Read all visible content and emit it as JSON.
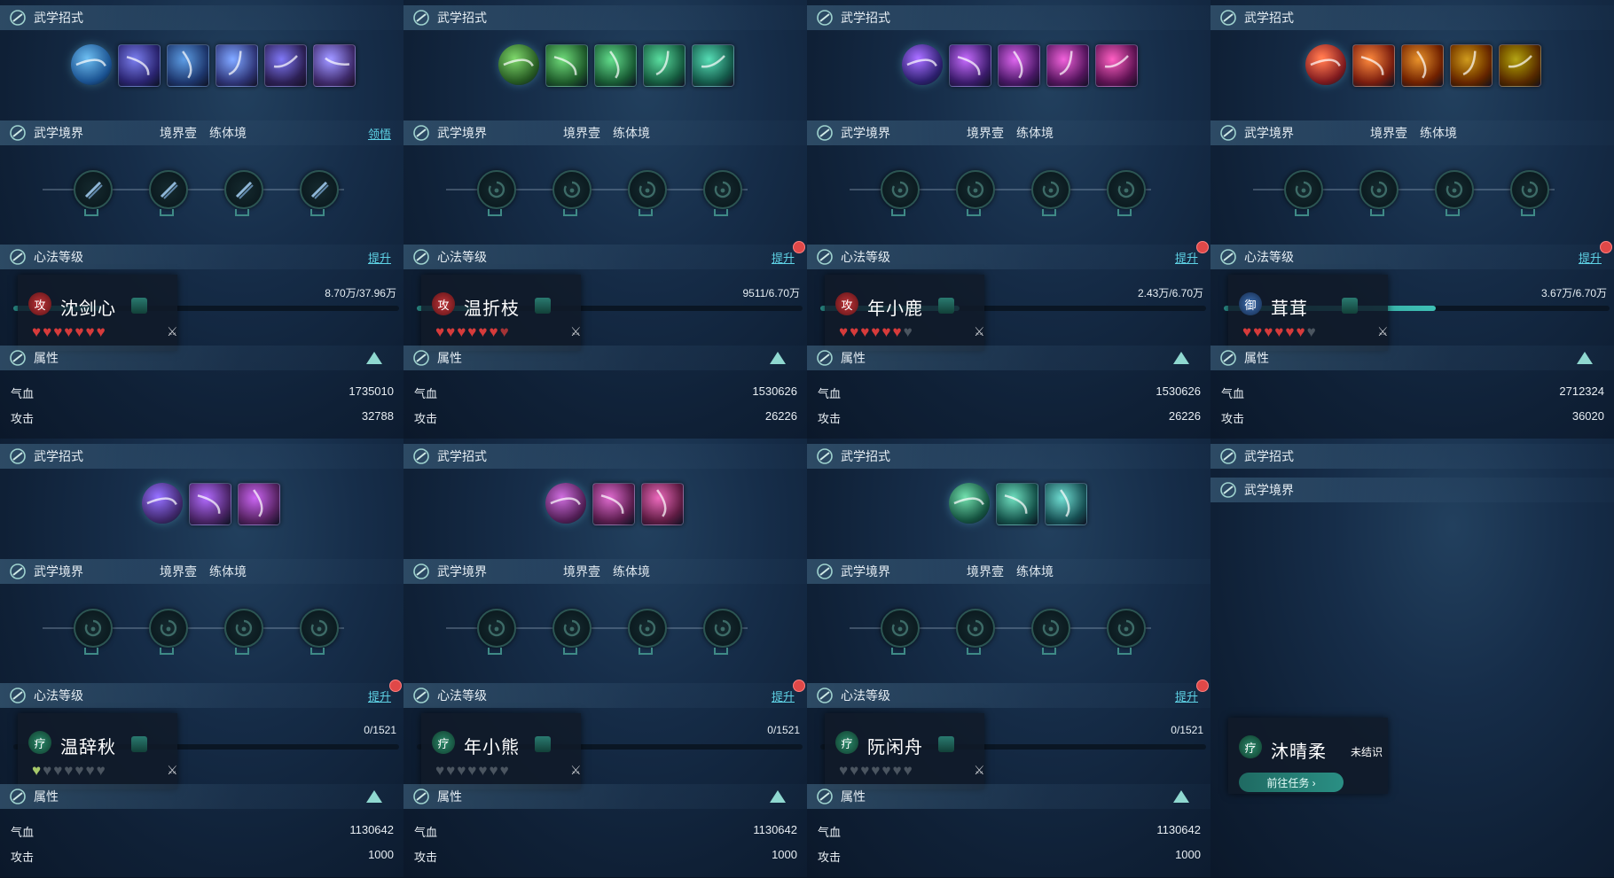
{
  "colors": {
    "accent": "#5fd3e6",
    "heart_red": "#d63b3b",
    "heart_green": "#a7c96a",
    "bar_teal": "#3ec0b5",
    "badge_red": "#e04848"
  },
  "panels": [
    {
      "skills_label": "武学招式",
      "realm_label": "武学境界",
      "realm_tags": [
        "境界壹",
        "练体境"
      ],
      "realm_link": "领悟",
      "level_label": "心法等级",
      "level_link": "提升",
      "has_dot": false,
      "level_text": "8.70万/37.96万",
      "level_progress": 0.23,
      "role_icon": "攻",
      "role": "atk",
      "name": "沈剑心",
      "hearts_red": 7,
      "hearts_green": 0,
      "attr_label": "属性",
      "hp_label": "气血",
      "hp_value": "1735010",
      "atk_label": "攻击",
      "atk_value": "32788",
      "skill_icons": [
        "blue-spiral-orb-icon",
        "lightning-slash-icon",
        "water-vortex-icon",
        "wind-blade-icon",
        "ice-pillar-icon",
        "ice-dash-icon"
      ]
    },
    {
      "skills_label": "武学招式",
      "realm_label": "武学境界",
      "realm_tags": [
        "境界壹",
        "练体境"
      ],
      "level_label": "心法等级",
      "level_link": "提升",
      "has_dot": true,
      "level_text": "9511/6.70万",
      "level_progress": 0.14,
      "role_icon": "攻",
      "role": "atk",
      "name": "温折枝",
      "hearts_red": 6.5,
      "hearts_green": 0,
      "attr_label": "属性",
      "hp_label": "气血",
      "hp_value": "1530626",
      "atk_label": "攻击",
      "atk_value": "26226",
      "skill_icons": [
        "green-spirit-icon",
        "leaf-blade-icon",
        "green-claw-icon",
        "jade-ring-icon",
        "yin-yang-icon"
      ]
    },
    {
      "skills_label": "武学招式",
      "realm_label": "武学境界",
      "realm_tags": [
        "境界壹",
        "练体境"
      ],
      "level_label": "心法等级",
      "level_link": "提升",
      "has_dot": true,
      "level_text": "2.43万/6.70万",
      "level_progress": 0.36,
      "role_icon": "攻",
      "role": "atk",
      "name": "年小鹿",
      "hearts_red": 6,
      "hearts_green": 0,
      "attr_label": "属性",
      "hp_label": "气血",
      "hp_value": "1530626",
      "atk_label": "攻击",
      "atk_value": "26226",
      "skill_icons": [
        "purple-rune-orb-icon",
        "green-starburst-icon",
        "blue-serpent-icon",
        "crimson-beast-icon",
        "violet-strike-icon"
      ]
    },
    {
      "skills_label": "武学招式",
      "realm_label": "武学境界",
      "realm_tags": [
        "境界壹",
        "练体境"
      ],
      "level_label": "心法等级",
      "level_link": "提升",
      "has_dot": true,
      "level_text": "3.67万/6.70万",
      "level_progress": 0.55,
      "role_icon": "御",
      "role": "def",
      "name": "茸茸",
      "hearts_red": 6,
      "hearts_green": 0,
      "attr_label": "属性",
      "hp_label": "气血",
      "hp_value": "2712324",
      "atk_label": "攻击",
      "atk_value": "36020",
      "skill_icons": [
        "fire-figure-icon",
        "golden-buddha-icon",
        "fire-burst-icon",
        "crescent-moon-icon",
        "flame-swirl-icon"
      ]
    },
    {
      "skills_label": "武学招式",
      "realm_label": "武学境界",
      "realm_tags": [
        "境界壹",
        "练体境"
      ],
      "level_label": "心法等级",
      "level_link": "提升",
      "has_dot": true,
      "level_text": "0/1521",
      "level_progress": 0,
      "role_icon": "疗",
      "role": "heal",
      "name": "温辞秋",
      "hearts_red": 0,
      "hearts_green": 1,
      "attr_label": "属性",
      "hp_label": "气血",
      "hp_value": "1130642",
      "atk_label": "攻击",
      "atk_value": "1000",
      "skill_icons": [
        "purple-wisp-icon",
        "golden-wings-icon",
        "cyan-gear-icon"
      ]
    },
    {
      "skills_label": "武学招式",
      "realm_label": "武学境界",
      "realm_tags": [
        "境界壹",
        "练体境"
      ],
      "level_label": "心法等级",
      "level_link": "提升",
      "has_dot": true,
      "level_text": "0/1521",
      "level_progress": 0,
      "role_icon": "疗",
      "role": "heal",
      "name": "年小熊",
      "hearts_red": 0,
      "hearts_green": 0,
      "attr_label": "属性",
      "hp_label": "气血",
      "hp_value": "1130642",
      "atk_label": "攻击",
      "atk_value": "1000",
      "skill_icons": [
        "violet-flame-icon",
        "pink-bird-icon",
        "blue-shark-icon"
      ]
    },
    {
      "skills_label": "武学招式",
      "realm_label": "武学境界",
      "realm_tags": [
        "境界壹",
        "练体境"
      ],
      "level_label": "心法等级",
      "level_link": "提升",
      "has_dot": true,
      "level_text": "0/1521",
      "level_progress": 0,
      "role_icon": "疗",
      "role": "heal",
      "name": "阮闲舟",
      "hearts_red": 0,
      "hearts_green": 0,
      "attr_label": "属性",
      "hp_label": "气血",
      "hp_value": "1130642",
      "atk_label": "攻击",
      "atk_value": "1000",
      "skill_icons": [
        "jade-leaf-icon",
        "teal-fairy-icon",
        "green-sparkle-icon"
      ]
    },
    {
      "skills_label": "武学招式",
      "realm_label": "武学境界",
      "locked": true,
      "role_icon": "疗",
      "role": "heal",
      "name": "沐晴柔",
      "unknown_label": "未结识",
      "task_button": "前往任务 ›"
    }
  ]
}
